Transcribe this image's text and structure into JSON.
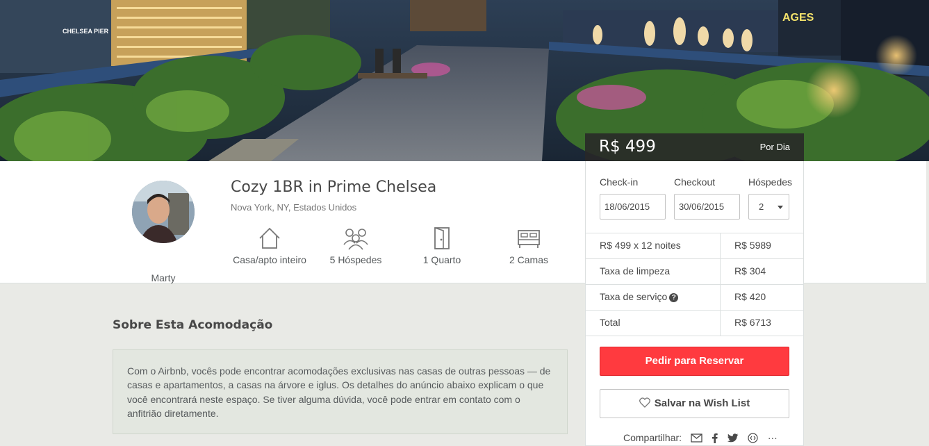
{
  "listing": {
    "title": "Cozy 1BR in Prime Chelsea",
    "location": "Nova York, NY, Estados Unidos",
    "host_name": "Marty"
  },
  "amenities": [
    {
      "icon": "house-icon",
      "label": "Casa/apto inteiro"
    },
    {
      "icon": "guests-icon",
      "label": "5 Hóspedes"
    },
    {
      "icon": "door-icon",
      "label": "1 Quarto"
    },
    {
      "icon": "bed-icon",
      "label": "2 Camas"
    }
  ],
  "booking": {
    "price": "R$ 499",
    "per": "Por Dia",
    "checkin_label": "Check-in",
    "checkin_value": "18/06/2015",
    "checkout_label": "Checkout",
    "checkout_value": "30/06/2015",
    "guests_label": "Hóspedes",
    "guests_value": "2",
    "rows": [
      {
        "label": "R$ 499 x 12 noites",
        "value": "R$ 5989"
      },
      {
        "label": "Taxa de limpeza",
        "value": "R$ 304"
      },
      {
        "label": "Taxa de serviço",
        "value": "R$ 420"
      },
      {
        "label": "Total",
        "value": "R$ 6713"
      }
    ],
    "book_button": "Pedir para Reservar",
    "wishlist_button": "Salvar na Wish List",
    "share_label": "Compartilhar:"
  },
  "about": {
    "heading": "Sobre Esta Acomodação",
    "text": "Com o Airbnb, vocês pode encontrar acomodações exclusivas nas casas de outras pessoas — de casas e apartamentos, a casas na árvore e iglus. Os detalhes do anúncio abaixo explicam o que você encontrará neste espaço. Se tiver alguma dúvida, você pode entrar em contato com o anfitrião diretamente."
  },
  "colors": {
    "accent": "#ff3a3f",
    "text": "#484848",
    "muted": "#767676",
    "about_bg": "#e3e7e0"
  },
  "hero": {
    "sign_text": "CHELSEA PIER",
    "billboard_text": "AGES"
  }
}
